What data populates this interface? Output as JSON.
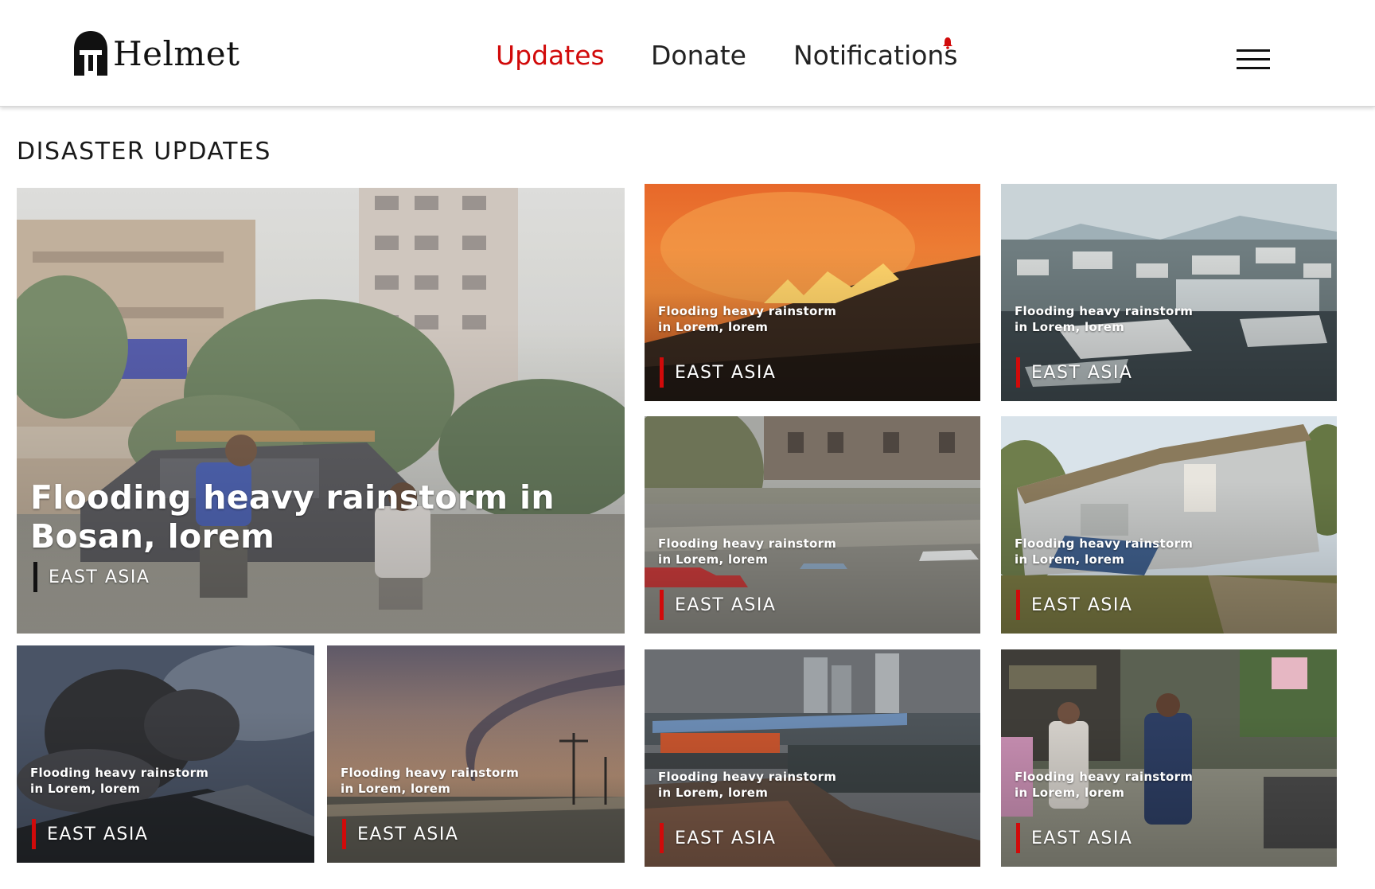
{
  "header": {
    "logo_text": "Helmet",
    "nav": {
      "updates": "Updates",
      "donate": "Donate",
      "notifications": "Notifications"
    },
    "active_color": "#d10a0a"
  },
  "section_title": "DISASTER UPDATES",
  "featured": {
    "title": "Flooding  heavy rainstorm in Bosan, lorem",
    "region": "EAST ASIA",
    "image": "flooded-street-car-push"
  },
  "cards": [
    {
      "title": "Flooding  heavy rainstorm\nin Lorem, lorem",
      "region": "EAST ASIA",
      "image": "wildfire"
    },
    {
      "title": "Flooding  heavy rainstorm\nin Lorem, lorem",
      "region": "EAST ASIA",
      "image": "tsunami-harbor"
    },
    {
      "title": "Flooding  heavy rainstorm\nin Lorem, lorem",
      "region": "EAST ASIA",
      "image": "flooded-river-cars"
    },
    {
      "title": "Flooding  heavy rainstorm\nin Lorem, lorem",
      "region": "EAST ASIA",
      "image": "collapsed-house"
    },
    {
      "title": "Flooding  heavy rainstorm\nin Lorem, lorem",
      "region": "EAST ASIA",
      "image": "volcano-ash"
    },
    {
      "title": "Flooding  heavy rainstorm\nin Lorem, lorem",
      "region": "EAST ASIA",
      "image": "tornado"
    },
    {
      "title": "Flooding  heavy rainstorm\nin Lorem, lorem",
      "region": "EAST ASIA",
      "image": "hurricane-city-debris"
    },
    {
      "title": "Flooding  heavy rainstorm\nin Lorem, lorem",
      "region": "EAST ASIA",
      "image": "flooded-market-street"
    }
  ]
}
